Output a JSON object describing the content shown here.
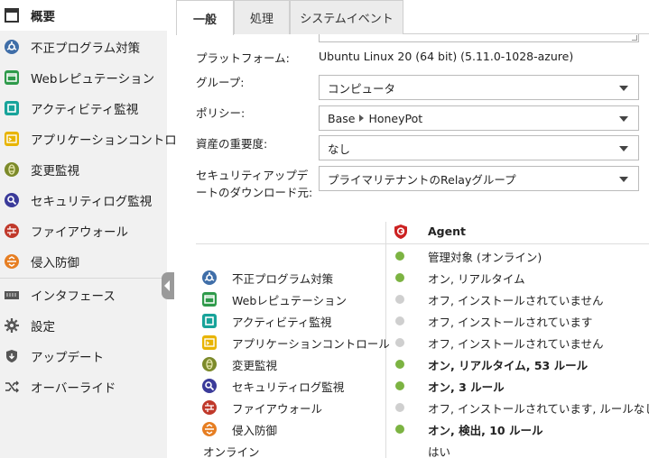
{
  "sidebar": {
    "items": [
      {
        "label": "概要",
        "icon": "overview-icon",
        "active": true
      },
      {
        "label": "不正プログラム対策",
        "icon": "anti-malware-icon"
      },
      {
        "label": "Webレピュテーション",
        "icon": "web-reputation-icon"
      },
      {
        "label": "アクティビティ監視",
        "icon": "activity-monitoring-icon"
      },
      {
        "label": "アプリケーションコントロール",
        "icon": "application-control-icon"
      },
      {
        "label": "変更監視",
        "icon": "integrity-monitoring-icon"
      },
      {
        "label": "セキュリティログ監視",
        "icon": "log-inspection-icon"
      },
      {
        "label": "ファイアウォール",
        "icon": "firewall-icon"
      },
      {
        "label": "侵入防御",
        "icon": "intrusion-prevention-icon"
      },
      {
        "label": "インタフェース",
        "icon": "interfaces-icon"
      },
      {
        "label": "設定",
        "icon": "settings-icon"
      },
      {
        "label": "アップデート",
        "icon": "updates-icon"
      },
      {
        "label": "オーバーライド",
        "icon": "overrides-icon"
      }
    ]
  },
  "tabs": [
    "一般",
    "処理",
    "システムイベント"
  ],
  "form": {
    "platform_label": "プラットフォーム:",
    "platform_value": "Ubuntu Linux 20 (64 bit) (5.11.0-1028-azure)",
    "group_label": "グループ:",
    "group_value": "コンピュータ",
    "policy_label": "ポリシー:",
    "policy_parent": "Base",
    "policy_child": "HoneyPot",
    "criticality_label": "資産の重要度:",
    "criticality_value": "なし",
    "update_source_label_1": "セキュリティアップデ",
    "update_source_label_2": "ートのダウンロード元:",
    "update_source_value": "プライマリテナントのRelayグループ"
  },
  "status": {
    "agent_header": "Agent",
    "agent_status": "管理対象 (オンライン)",
    "online_label": "オンライン",
    "online_value": "はい",
    "features": [
      {
        "label": "不正プログラム対策",
        "icon": "anti-malware-icon",
        "status": "オン, リアルタイム",
        "dot": "#7cb342",
        "bold": false
      },
      {
        "label": "Webレピュテーション",
        "icon": "web-reputation-icon",
        "status": "オフ, インストールされていません",
        "dot": "#cfcfcf",
        "bold": false
      },
      {
        "label": "アクティビティ監視",
        "icon": "activity-monitoring-icon",
        "status": "オフ, インストールされています",
        "dot": "#cfcfcf",
        "bold": false
      },
      {
        "label": "アプリケーションコントロール",
        "icon": "application-control-icon",
        "status": "オフ, インストールされていません",
        "dot": "#cfcfcf",
        "bold": false
      },
      {
        "label": "変更監視",
        "icon": "integrity-monitoring-icon",
        "status": "オン, リアルタイム, 53 ルール",
        "dot": "#7cb342",
        "bold": true
      },
      {
        "label": "セキュリティログ監視",
        "icon": "log-inspection-icon",
        "status": "オン, 3 ルール",
        "dot": "#7cb342",
        "bold": true
      },
      {
        "label": "ファイアウォール",
        "icon": "firewall-icon",
        "status": "オフ, インストールされています, ルールなし",
        "dot": "#cfcfcf",
        "bold": false
      },
      {
        "label": "侵入防御",
        "icon": "intrusion-prevention-icon",
        "status": "オン, 検出, 10 ルール",
        "dot": "#7cb342",
        "bold": true
      }
    ]
  },
  "colors": {
    "anti_malware": "#3f6ea8",
    "web_reputation": "#2e9a4a",
    "activity": "#17a39a",
    "app_control": "#e8b400",
    "integrity": "#7c8a2a",
    "log": "#3b3b9a",
    "firewall": "#c0392b",
    "ips": "#e67e22",
    "agent_shield": "#cc2222",
    "online_dot": "#7cb342",
    "offline_dot": "#cfcfcf"
  }
}
